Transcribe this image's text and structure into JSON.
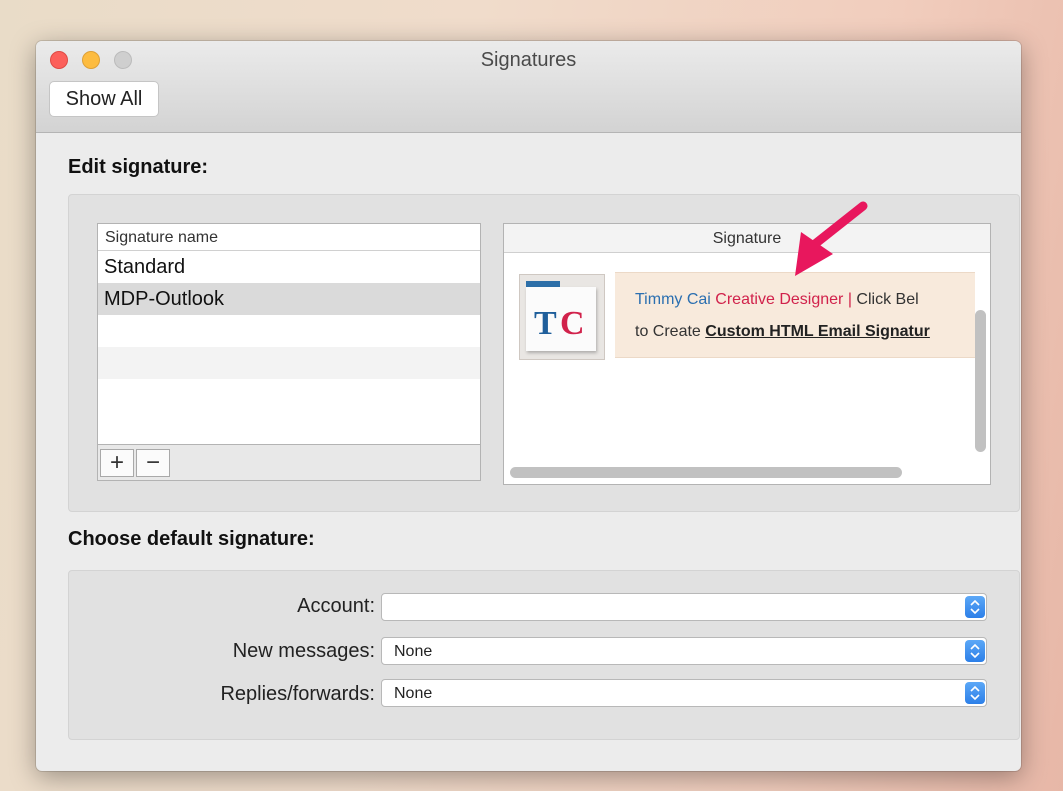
{
  "window": {
    "title": "Signatures",
    "show_all_label": "Show All"
  },
  "edit": {
    "heading": "Edit signature:",
    "list_header": "Signature name",
    "signatures": [
      "Standard",
      "MDP-Outlook"
    ],
    "selected_index": 1,
    "add_symbol": "+",
    "remove_symbol": "−",
    "preview_header": "Signature",
    "preview": {
      "logo_letters": [
        "T",
        "C"
      ],
      "name": "Timmy Cai",
      "role": "Creative Designer",
      "separator": "|",
      "cta": "Click Bel",
      "line2_prefix": "to Create",
      "line2_link": "Custom HTML Email Signatur",
      "colors": {
        "name": "#2b6fb0",
        "role": "#d1224b",
        "card": "#f8eadc"
      }
    }
  },
  "defaults": {
    "heading": "Choose default signature:",
    "account_label": "Account:",
    "account_value": "",
    "new_messages_label": "New messages:",
    "new_messages_value": "None",
    "replies_label": "Replies/forwards:",
    "replies_value": "None"
  },
  "annotation": {
    "arrow_color": "#e8175d"
  }
}
